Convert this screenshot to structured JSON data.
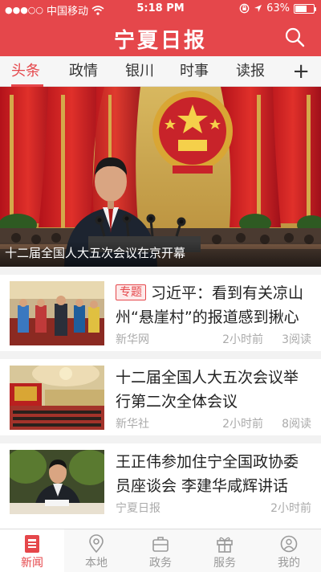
{
  "status_bar": {
    "signal_dots": "●●●○○",
    "carrier": "中国移动",
    "time": "5:18 PM",
    "battery_percent": "63%",
    "battery_level": 0.63
  },
  "header": {
    "title": "宁夏日报"
  },
  "tabs": [
    {
      "label": "头条",
      "active": true
    },
    {
      "label": "政情",
      "active": false
    },
    {
      "label": "银川",
      "active": false
    },
    {
      "label": "时事",
      "active": false
    },
    {
      "label": "读报",
      "active": false
    }
  ],
  "tabs_add_label": "+",
  "hero": {
    "caption": "十二届全国人大五次会议在京开幕"
  },
  "news": [
    {
      "badge": "专题",
      "title": "习近平：看到有关凉山州“悬崖村”的报道感到揪心",
      "source": "新华网",
      "time": "2小时前",
      "reads": "3阅读"
    },
    {
      "badge": "",
      "title": "十二届全国人大五次会议举行第二次全体会议",
      "source": "新华社",
      "time": "2小时前",
      "reads": "8阅读"
    },
    {
      "badge": "",
      "title": "王正伟参加住宁全国政协委员座谈会 李建华咸辉讲话",
      "source": "宁夏日报",
      "time": "2小时前",
      "reads": ""
    }
  ],
  "bottom_nav": [
    {
      "label": "新闻",
      "icon": "news-icon",
      "active": true
    },
    {
      "label": "本地",
      "icon": "location-pin-icon",
      "active": false
    },
    {
      "label": "政务",
      "icon": "briefcase-icon",
      "active": false
    },
    {
      "label": "服务",
      "icon": "gift-icon",
      "active": false
    },
    {
      "label": "我的",
      "icon": "user-icon",
      "active": false
    }
  ],
  "colors": {
    "brand_red": "#e5474b",
    "inactive_gray": "#999999"
  }
}
